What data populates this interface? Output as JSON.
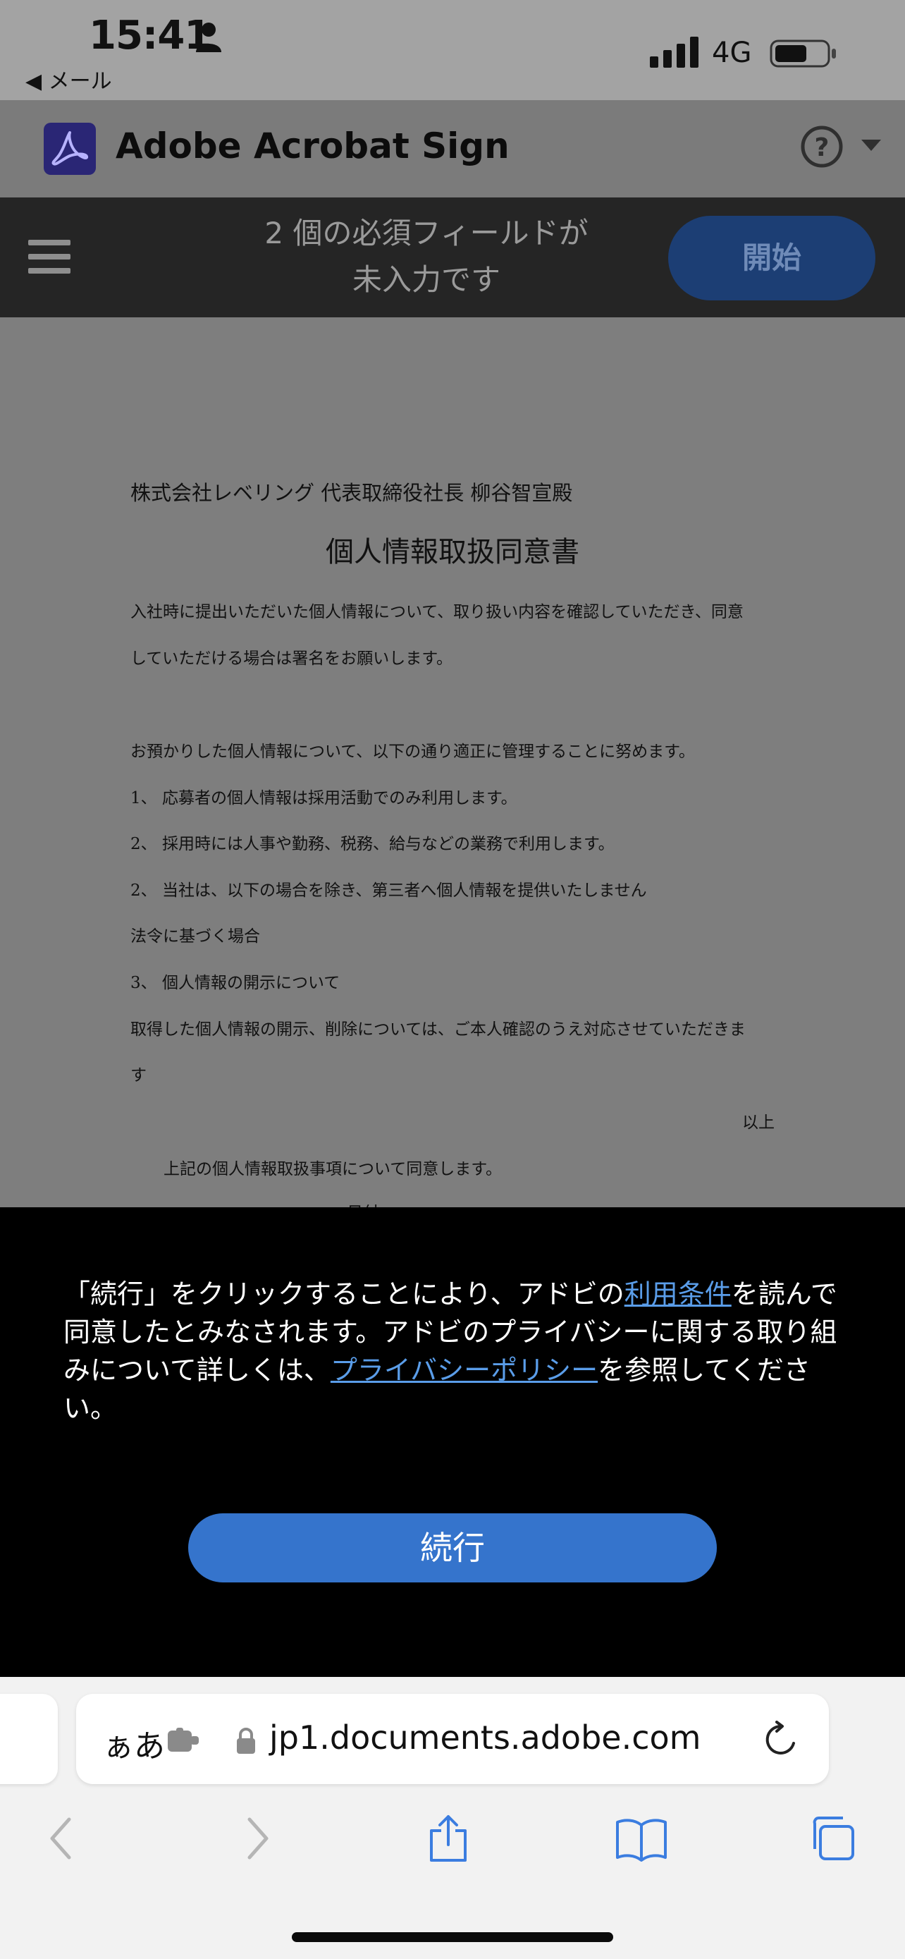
{
  "status_bar": {
    "time": "15:41",
    "back_app": "◀ メール",
    "network": "4G",
    "icons": [
      "person-icon",
      "signal-icon",
      "battery-icon"
    ]
  },
  "header": {
    "app_title": "Adobe Acrobat Sign",
    "icons": [
      "adobe-logo-icon",
      "help-icon",
      "chevron-down-icon"
    ]
  },
  "field_bar": {
    "notice_line1": "2 個の必須フィールドが",
    "notice_line2": "未入力です",
    "start_label": "開始",
    "icons": [
      "menu-icon"
    ]
  },
  "document": {
    "addressee": "株式会社レベリング 代表取締役社長 柳谷智宣殿",
    "title": "個人情報取扱同意書",
    "lines": [
      "入社時に提出いただいた個人情報について、取り扱い内容を確認していただき、同意",
      "していただける場合は署名をお願いします。",
      "お預かりした個人情報について、以下の通り適正に管理することに努めます。",
      "1、 応募者の個人情報は採用活動でのみ利用します。",
      "2、 採用時には人事や勤務、税務、給与などの業務で利用します。",
      "2、 当社は、以下の場合を除き、第三者へ個人情報を提供いたしません",
      "法令に基づく場合",
      "3、 個人情報の開示について",
      "取得した個人情報の開示、削除については、ご本人確認のうえ対応させていただきま",
      "す"
    ],
    "closing": "以上",
    "agreement": "上記の個人情報取扱事項について同意します。",
    "date_label": "日付"
  },
  "consent": {
    "text_part1": "「続行」をクリックすることにより、アドビの",
    "terms_link": "利用条件",
    "text_part2": "を読んで同意したとみなされます。アドビのプライバシーに関する取り組みについて詳しくは、",
    "privacy_link": "プライバシーポリシー",
    "text_part3": "を参照してください。",
    "continue_label": "続行"
  },
  "safari": {
    "aa_label": "ぁあ",
    "url": "jp1.documents.adobe.com",
    "icons": [
      "extension-icon",
      "lock-icon",
      "reload-icon",
      "back-arrow-icon",
      "forward-arrow-icon",
      "share-icon",
      "bookmarks-icon",
      "tabs-icon"
    ]
  },
  "colors": {
    "consent_button": "#3574cc",
    "link": "#5a9de9",
    "start_button": "#1c3e74"
  }
}
